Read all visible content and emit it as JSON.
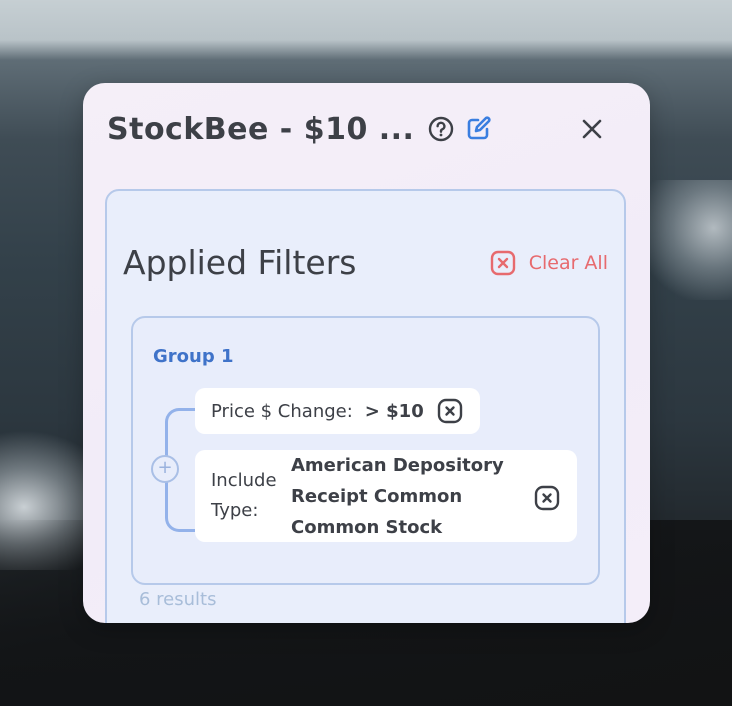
{
  "panel": {
    "title": "StockBee - $10 ...",
    "icons": {
      "help": "help-circle-icon",
      "edit": "edit-icon",
      "close": "close-icon"
    }
  },
  "filters": {
    "heading": "Applied Filters",
    "clear_all_label": "Clear All",
    "groups": [
      {
        "label": "Group 1",
        "conditions": [
          {
            "label": "Price $ Change:",
            "value": "> $10"
          },
          {
            "label": "Include Type:",
            "value": "American Depository Receipt Common Common Stock"
          }
        ]
      }
    ],
    "results_text": "6 results"
  },
  "colors": {
    "accent": "#3f73c9",
    "danger": "#e76a6e",
    "edit_icon": "#3a7ee0",
    "border": "#b6c9ea"
  }
}
